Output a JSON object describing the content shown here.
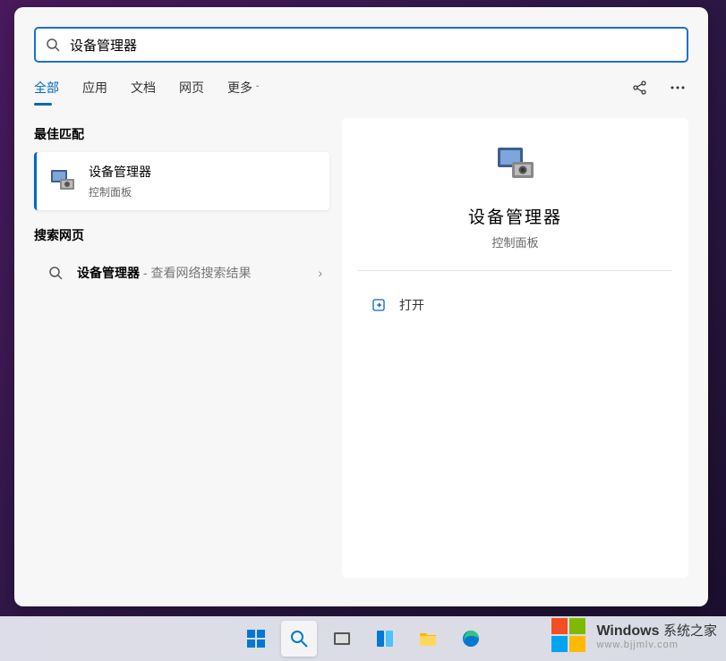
{
  "search": {
    "query": "设备管理器"
  },
  "tabs": {
    "all": "全部",
    "apps": "应用",
    "docs": "文档",
    "web": "网页",
    "more": "更多"
  },
  "sections": {
    "best_match": "最佳匹配",
    "search_web": "搜索网页"
  },
  "best_result": {
    "title": "设备管理器",
    "sub": "控制面板"
  },
  "web_result": {
    "term": "设备管理器",
    "suffix": " - 查看网络搜索结果"
  },
  "preview": {
    "title": "设备管理器",
    "sub": "控制面板",
    "open": "打开"
  },
  "watermark": {
    "brand_en": "Windows",
    "brand_cn": "系统之家",
    "url": "www.bjjmlv.com"
  }
}
